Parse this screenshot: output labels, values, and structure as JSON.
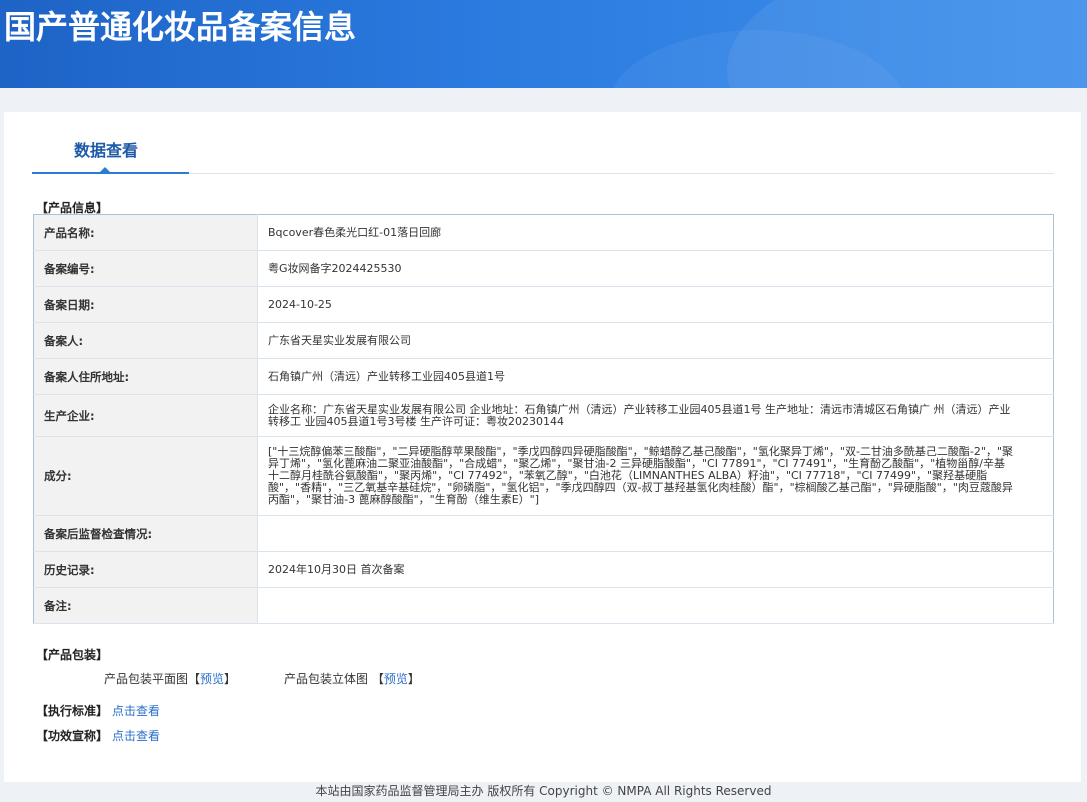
{
  "header": {
    "title": "国产普通化妆品备案信息"
  },
  "tabs": [
    {
      "label": "数据查看"
    }
  ],
  "product_info": {
    "section_title": "【产品信息】",
    "rows": [
      {
        "key": "产品名称:",
        "value": "Bqcover春色柔光口红-01落日回廊"
      },
      {
        "key": "备案编号:",
        "value": "粤G妆网备字2024425530"
      },
      {
        "key": "备案日期:",
        "value": "2024-10-25"
      },
      {
        "key": "备案人:",
        "value": "广东省天星实业发展有限公司"
      },
      {
        "key": "备案人住所地址:",
        "value": "石角镇广州（清远）产业转移工业园405县道1号"
      },
      {
        "key": "生产企业:",
        "value": "企业名称：广东省天星实业发展有限公司 企业地址：石角镇广州（清远）产业转移工业园405县道1号 生产地址：清远市清城区石角镇广 州（清远）产业转移工 业园405县道1号3号楼 生产许可证：粤妆20230144"
      },
      {
        "key": "成分:",
        "value": "[\"十三烷醇偏苯三酸酯\"，\"二异硬脂醇苹果酸酯\"，\"季戊四醇四异硬脂酸酯\"，\"鲸蜡醇乙基己酸酯\"，\"氢化聚异丁烯\"，\"双-二甘油多酰基己二酸酯-2\"，\"聚异丁烯\"，\"氢化蓖麻油二聚亚油酸酯\"，\"合成蜡\"，\"聚乙烯\"，\"聚甘油-2 三异硬脂酸酯\"，\"CI 77891\"，\"CI 77491\"，\"生育酚乙酸酯\"，\"植物甾醇/辛基十二醇月桂酰谷氨酸酯\"，\"聚丙烯\"，\"CI 77492\"，\"苯氧乙醇\"，\"白池花（LIMNANTHES ALBA）籽油\"，\"CI 77718\"，\"CI 77499\"，\"聚羟基硬脂酸\"，\"香精\"，\"三乙氧基辛基硅烷\"，\"卵磷脂\"，\"氢化铝\"，\"季戊四醇四（双-叔丁基羟基氢化肉桂酸）酯\"，\"棕榈酸乙基己酯\"，\"异硬脂酸\"，\"肉豆蔻酸异丙酯\"，\"聚甘油-3 蓖麻醇酸酯\"，\"生育酚（维生素E）\"]"
      },
      {
        "key": "备案后监督检查情况:",
        "value": ""
      },
      {
        "key": "历史记录:",
        "value": "2024年10月30日 首次备案"
      },
      {
        "key": "备注:",
        "value": ""
      }
    ]
  },
  "packaging": {
    "section_title": "【产品包装】",
    "flat_label": "产品包装平面图【",
    "flat_link": "预览",
    "flat_close": "】",
    "solid_label": "产品包装立体图 【",
    "solid_link": "预览",
    "solid_close": "】"
  },
  "standard": {
    "section_title": "【执行标准】",
    "link": "点击查看"
  },
  "efficacy": {
    "section_title": "【功效宣称】",
    "link": "点击查看"
  },
  "footer": {
    "text": "本站由国家药品监督管理局主办 版权所有 Copyright © NMPA All Rights Reserved"
  }
}
